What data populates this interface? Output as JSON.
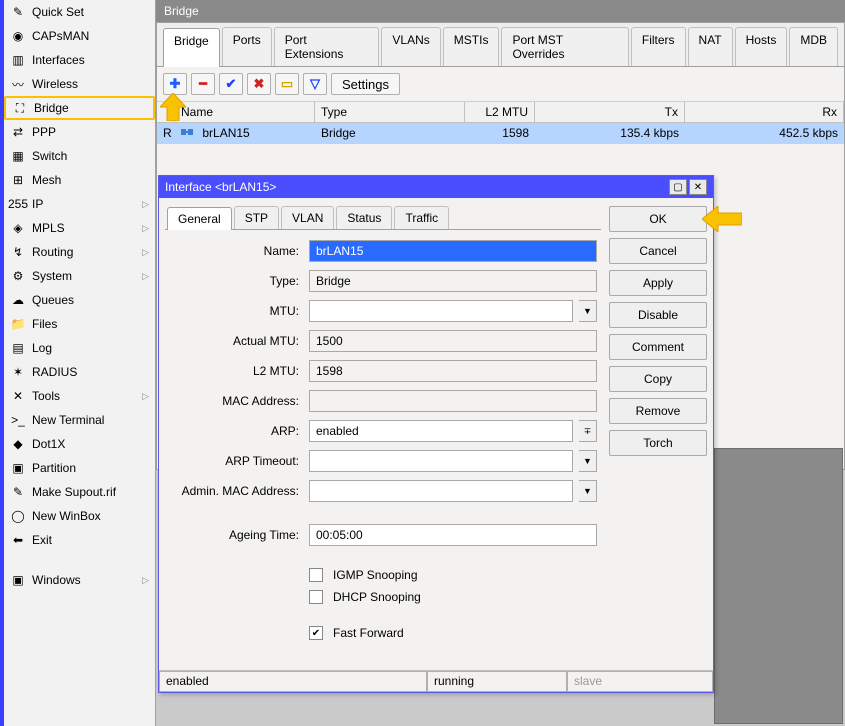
{
  "sidebar": {
    "items": [
      {
        "label": "Quick Set",
        "icon": "✎"
      },
      {
        "label": "CAPsMAN",
        "icon": "◉"
      },
      {
        "label": "Interfaces",
        "icon": "▥"
      },
      {
        "label": "Wireless",
        "icon": "〰"
      },
      {
        "label": "Bridge",
        "icon": "⛶"
      },
      {
        "label": "PPP",
        "icon": "⇄"
      },
      {
        "label": "Switch",
        "icon": "▦"
      },
      {
        "label": "Mesh",
        "icon": "⊞"
      },
      {
        "label": "IP",
        "icon": "255",
        "chevron": true
      },
      {
        "label": "MPLS",
        "icon": "◈",
        "chevron": true
      },
      {
        "label": "Routing",
        "icon": "↯",
        "chevron": true
      },
      {
        "label": "System",
        "icon": "⚙",
        "chevron": true
      },
      {
        "label": "Queues",
        "icon": "☁"
      },
      {
        "label": "Files",
        "icon": "📁"
      },
      {
        "label": "Log",
        "icon": "▤"
      },
      {
        "label": "RADIUS",
        "icon": "✶"
      },
      {
        "label": "Tools",
        "icon": "✕",
        "chevron": true
      },
      {
        "label": "New Terminal",
        "icon": ">_"
      },
      {
        "label": "Dot1X",
        "icon": "◆"
      },
      {
        "label": "Partition",
        "icon": "▣"
      },
      {
        "label": "Make Supout.rif",
        "icon": "✎"
      },
      {
        "label": "New WinBox",
        "icon": "◯"
      },
      {
        "label": "Exit",
        "icon": "⬅"
      }
    ],
    "windows_label": "Windows"
  },
  "bridge_window": {
    "title": "Bridge",
    "tabs": [
      "Bridge",
      "Ports",
      "Port Extensions",
      "VLANs",
      "MSTIs",
      "Port MST Overrides",
      "Filters",
      "NAT",
      "Hosts",
      "MDB"
    ],
    "toolbar": {
      "settings": "Settings"
    },
    "columns": [
      "",
      "Name",
      "Type",
      "L2 MTU",
      "Tx",
      "Rx"
    ],
    "rows": [
      {
        "flag": "R",
        "name": "brLAN15",
        "type": "Bridge",
        "l2": "1598",
        "tx": "135.4 kbps",
        "rx": "452.5 kbps"
      }
    ]
  },
  "dialog": {
    "title": "Interface <brLAN15>",
    "tabs": [
      "General",
      "STP",
      "VLAN",
      "Status",
      "Traffic"
    ],
    "fields": {
      "name_label": "Name:",
      "name_value": "brLAN15",
      "type_label": "Type:",
      "type_value": "Bridge",
      "mtu_label": "MTU:",
      "mtu_value": "",
      "actual_mtu_label": "Actual MTU:",
      "actual_mtu_value": "1500",
      "l2mtu_label": "L2 MTU:",
      "l2mtu_value": "1598",
      "mac_label": "MAC Address:",
      "mac_value": "",
      "arp_label": "ARP:",
      "arp_value": "enabled",
      "arp_to_label": "ARP Timeout:",
      "arp_to_value": "",
      "admin_mac_label": "Admin. MAC Address:",
      "admin_mac_value": "",
      "ageing_label": "Ageing Time:",
      "ageing_value": "00:05:00",
      "igmp_label": "IGMP Snooping",
      "dhcp_label": "DHCP Snooping",
      "ff_label": "Fast Forward"
    },
    "buttons": {
      "ok": "OK",
      "cancel": "Cancel",
      "apply": "Apply",
      "disable": "Disable",
      "comment": "Comment",
      "copy": "Copy",
      "remove": "Remove",
      "torch": "Torch"
    },
    "status": {
      "a": "enabled",
      "b": "running",
      "c": "slave"
    }
  }
}
